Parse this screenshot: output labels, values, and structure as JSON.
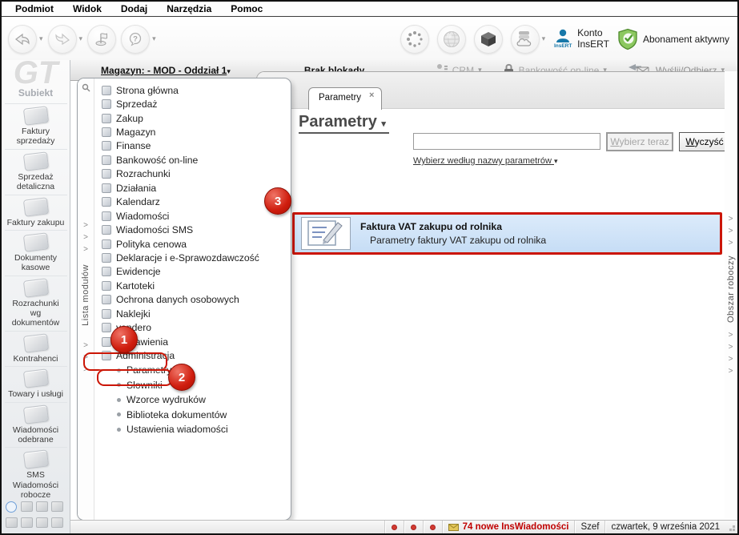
{
  "menubar": {
    "items": [
      "Podmiot",
      "Widok",
      "Dodaj",
      "Narzędzia",
      "Pomoc"
    ]
  },
  "toolbar": {
    "konto_line1": "Konto",
    "konto_line2": "InsERT",
    "insert_badge": "InsERT",
    "abonament_label": "Abonament aktywny"
  },
  "infobar": {
    "magazyn_link": "Magazyn: - MOD - Oddział 1",
    "blokada_link": "Brak blokady",
    "crm_label": "CRM",
    "bankowosc_label": "Bankowość on-line",
    "wyslij_label": "Wyślij/Odbierz"
  },
  "sidebar": {
    "logo": "GT",
    "logo_caption": "Subiekt",
    "modules": [
      {
        "label": "Faktury sprzedaży",
        "icon": "sales-invoices-icon"
      },
      {
        "label": "Sprzedaż detaliczna",
        "icon": "retail-sales-icon"
      },
      {
        "label": "Faktury zakupu",
        "icon": "purchase-invoices-icon"
      },
      {
        "label": "Dokumenty kasowe",
        "icon": "cash-documents-icon"
      },
      {
        "label": "Rozrachunki wg dokumentów",
        "icon": "settlements-by-documents-icon"
      },
      {
        "label": "Kontrahenci",
        "icon": "contractors-icon"
      },
      {
        "label": "Towary i usługi",
        "icon": "goods-and-services-icon"
      },
      {
        "label": "Wiadomości odebrane",
        "icon": "received-messages-icon"
      },
      {
        "label": "SMS Wiadomości robocze",
        "icon": "sms-draft-messages-icon"
      }
    ]
  },
  "module_strip": {
    "label": "Lista modułów"
  },
  "tree": {
    "items": [
      {
        "label": "Strona główna",
        "icon": "home-icon"
      },
      {
        "label": "Sprzedaż",
        "icon": "sales-icon"
      },
      {
        "label": "Zakup",
        "icon": "purchase-icon"
      },
      {
        "label": "Magazyn",
        "icon": "warehouse-icon"
      },
      {
        "label": "Finanse",
        "icon": "finance-icon"
      },
      {
        "label": "Bankowość on-line",
        "icon": "online-banking-icon"
      },
      {
        "label": "Rozrachunki",
        "icon": "settlements-icon"
      },
      {
        "label": "Działania",
        "icon": "activities-icon"
      },
      {
        "label": "Kalendarz",
        "icon": "calendar-icon"
      },
      {
        "label": "Wiadomości",
        "icon": "messages-icon"
      },
      {
        "label": "Wiadomości SMS",
        "icon": "sms-messages-icon"
      },
      {
        "label": "Polityka cenowa",
        "icon": "price-policy-icon"
      },
      {
        "label": "Deklaracje i e-Sprawozdawczość",
        "icon": "declarations-icon"
      },
      {
        "label": "Ewidencje",
        "icon": "records-icon"
      },
      {
        "label": "Kartoteki",
        "icon": "card-files-icon"
      },
      {
        "label": "Ochrona danych osobowych",
        "icon": "personal-data-protection-icon"
      },
      {
        "label": "Naklejki",
        "icon": "stickers-icon"
      },
      {
        "label": "vendero",
        "icon": "vendero-icon"
      },
      {
        "label": "Zestawienia",
        "icon": "reports-icon"
      },
      {
        "label": "Administracja",
        "icon": "administration-icon"
      }
    ],
    "admin_children": [
      {
        "label": "Parametry"
      },
      {
        "label": "Słowniki"
      },
      {
        "label": "Wzorce wydruków"
      },
      {
        "label": "Biblioteka dokumentów"
      },
      {
        "label": "Ustawienia wiadomości"
      }
    ]
  },
  "main": {
    "tab_label": "Parametry",
    "title": "Parametry",
    "search_value": "",
    "btn_select_now": "Wybierz teraz",
    "btn_clear": "Wyczyść",
    "link_by_name": "Wybierz według nazwy parametrów",
    "result": {
      "title": "Faktura VAT zakupu od rolnika",
      "description": "Parametry faktury VAT zakupu od rolnika"
    }
  },
  "right_strip": {
    "label": "Obszar roboczy"
  },
  "statusbar": {
    "messages": "74 nowe InsWiadomości",
    "user": "Szef",
    "date": "czwartek, 9 września 2021"
  },
  "annotations": {
    "step1": "1",
    "step2": "2",
    "step3": "3"
  },
  "colors": {
    "annotation_red": "#cf1d0e",
    "selection_blue": "#cfe4f8",
    "insert_blue": "#1878a9",
    "subscription_green": "#5fae3b",
    "alert_red": "#cc0000"
  }
}
